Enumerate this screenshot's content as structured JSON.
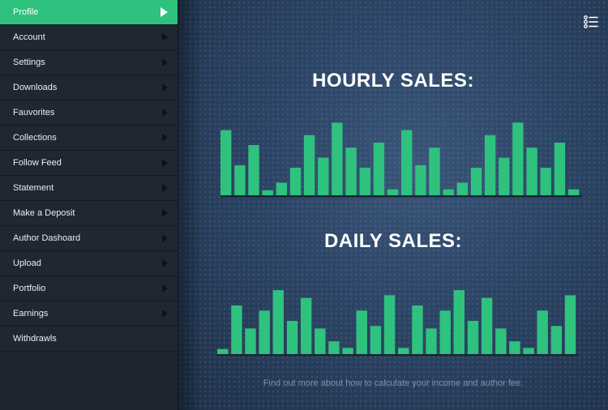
{
  "sidebar": {
    "items": [
      {
        "label": "Profile",
        "active": true,
        "arrow": true
      },
      {
        "label": "Account",
        "active": false,
        "arrow": true
      },
      {
        "label": "Settings",
        "active": false,
        "arrow": true
      },
      {
        "label": "Downloads",
        "active": false,
        "arrow": true
      },
      {
        "label": "Fauvorites",
        "active": false,
        "arrow": true
      },
      {
        "label": "Collections",
        "active": false,
        "arrow": true
      },
      {
        "label": "Follow Feed",
        "active": false,
        "arrow": true
      },
      {
        "label": "Statement",
        "active": false,
        "arrow": true
      },
      {
        "label": "Make a Deposit",
        "active": false,
        "arrow": true
      },
      {
        "label": "Author Dashoard",
        "active": false,
        "arrow": true
      },
      {
        "label": "Upload",
        "active": false,
        "arrow": true
      },
      {
        "label": "Portfolio",
        "active": false,
        "arrow": true
      },
      {
        "label": "Earnings",
        "active": false,
        "arrow": true
      },
      {
        "label": "Withdrawls",
        "active": false,
        "arrow": false
      }
    ]
  },
  "header": {
    "menu_icon": "list-menu-icon"
  },
  "main": {
    "hourly_title": "HOURLY SALES:",
    "daily_title": "DAILY SALES:",
    "footer": "Find out more about how to calculate your income and author fee."
  },
  "colors": {
    "accent": "#2ec27e",
    "sidebar": "#1e2732",
    "bar": "#2ec27e"
  },
  "chart_data": [
    {
      "type": "bar",
      "values": [
        13,
        6,
        10,
        1,
        2.5,
        5.5,
        12,
        7.5,
        14.5,
        9.5,
        5.5,
        10.5,
        1.2,
        13,
        6,
        9.5,
        1.2,
        2.5,
        5.5,
        12,
        7.5,
        14.5,
        9.5,
        5.5,
        10.5,
        1.2
      ],
      "ylim": [
        0,
        16
      ]
    },
    {
      "type": "bar",
      "values": [
        1,
        9.5,
        5,
        8.5,
        12.5,
        6.5,
        11,
        5,
        2.5,
        1.2,
        8.5,
        5.5,
        11.5,
        1.2,
        9.5,
        5,
        8.5,
        12.5,
        6.5,
        11,
        5,
        2.5,
        1.2,
        8.5,
        5.5,
        11.5
      ],
      "ylim": [
        0,
        16
      ]
    }
  ]
}
